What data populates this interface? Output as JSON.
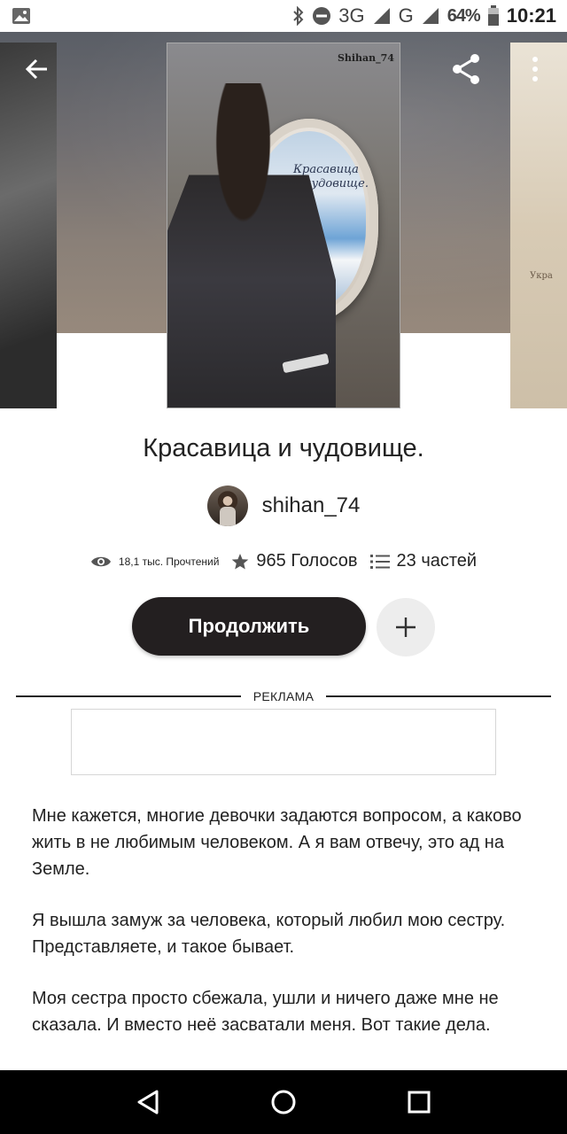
{
  "status_bar": {
    "network": "3G",
    "network_sup": "3G",
    "network2": "G",
    "battery": "64%",
    "time": "10:21"
  },
  "icons": {
    "back": "arrow-left-icon",
    "share": "share-icon",
    "more": "more-vertical-icon",
    "views": "eye-icon",
    "votes": "star-icon",
    "parts": "list-icon",
    "add": "plus-icon",
    "nav_back": "triangle-back-icon",
    "nav_home": "circle-home-icon",
    "nav_recents": "square-recents-icon"
  },
  "cover": {
    "title_line1": "Красавица",
    "title_line2": "и чудовище.",
    "author_tag": "Shihan_74",
    "right_cover_text": "Укра"
  },
  "story": {
    "title": "Красавица и чудовище.",
    "author": "shihan_74",
    "reads": "18,1 тыс. Прочтений",
    "votes": "965 Голосов",
    "parts": "23 частей",
    "continue_label": "Продолжить"
  },
  "ad": {
    "label": "РЕКЛАМА"
  },
  "description": {
    "paragraphs": [
      "Мне кажется, многие девочки задаются вопросом, а каково жить в не любимым человеком. А я вам отвечу, это ад на Земле.",
      "Я вышла замуж за человека, который любил мою сестру. Представляете, и такое бывает.",
      "Моя сестра просто сбежала, ушли и ничего даже мне не сказала. И вместо неё засватали меня. Вот такие дела."
    ]
  },
  "colors": {
    "continue_bg": "#231f20",
    "add_bg": "#ededed",
    "nav_bg": "#000000"
  }
}
